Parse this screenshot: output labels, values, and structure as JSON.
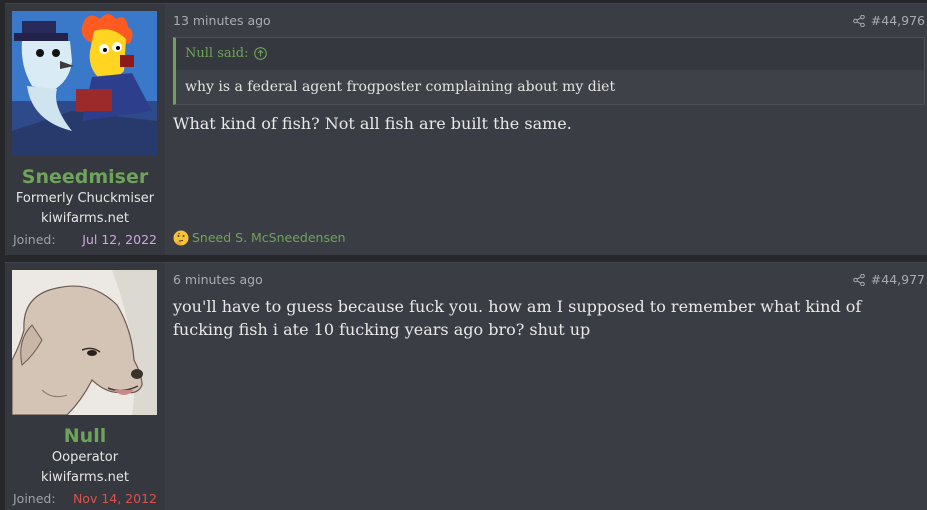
{
  "posts": [
    {
      "user": {
        "name": "Sneedmiser",
        "title": "Formerly Chuckmiser",
        "site": "kiwifarms.net",
        "joined_label": "Joined:",
        "joined_date": "Jul 12, 2022",
        "joined_color": "#d7a2e8",
        "avatar": "cartoon-snowman-avatar"
      },
      "time": "13 minutes ago",
      "number": "#44,976",
      "quote": {
        "author": "Null said:",
        "text": "why is a federal agent frogposter complaining about my diet"
      },
      "message": "What kind of fish? Not all fish are built the same.",
      "reaction": {
        "icon": "thinking-emoji-icon",
        "user": "Sneed S. McSneedensen"
      }
    },
    {
      "user": {
        "name": "Null",
        "title": "Ooperator",
        "site": "kiwifarms.net",
        "joined_label": "Joined:",
        "joined_date": "Nov 14, 2012",
        "joined_color": "#d9534f",
        "avatar": "dog-drawing-avatar"
      },
      "time": "6 minutes ago",
      "number": "#44,977",
      "message": "you'll have to guess because fuck you. how am I supposed to remember what kind of fucking fish i ate 10 fucking years ago bro? shut up"
    }
  ],
  "colors": {
    "accent": "#6fa35b",
    "background": "#25272b",
    "post_bg": "#3a3d43",
    "user_bg": "#35383e"
  }
}
